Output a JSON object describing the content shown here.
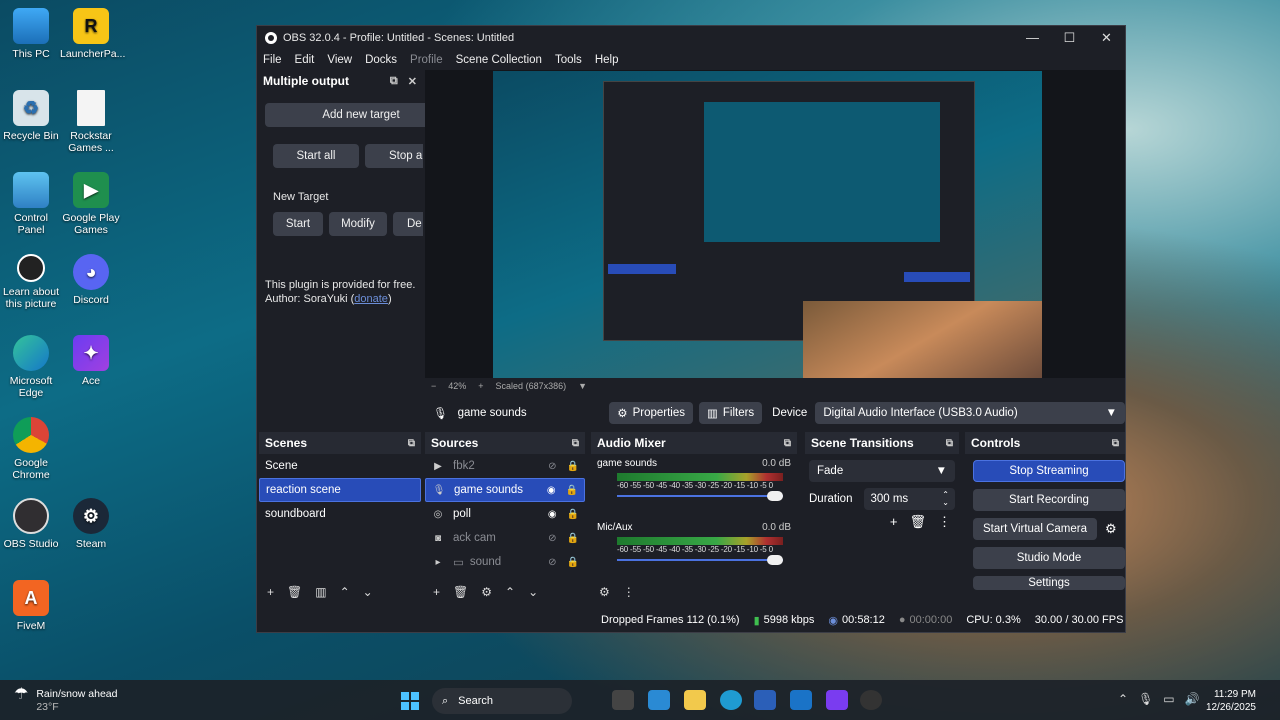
{
  "desktop": {
    "icons": [
      {
        "label": "This PC"
      },
      {
        "label": "LauncherPa..."
      },
      {
        "label": "Recycle Bin"
      },
      {
        "label": "Rockstar Games ..."
      },
      {
        "label": "Control Panel"
      },
      {
        "label": "Google Play Games"
      },
      {
        "label": "Learn about this picture"
      },
      {
        "label": "Discord"
      },
      {
        "label": "Microsoft Edge"
      },
      {
        "label": "Ace"
      },
      {
        "label": "Google Chrome"
      },
      {
        "label": "OBS Studio"
      },
      {
        "label": "Steam"
      },
      {
        "label": "FiveM"
      }
    ]
  },
  "window": {
    "title": "OBS 32.0.4 - Profile: Untitled - Scenes: Untitled",
    "controls": {
      "minimize": "—",
      "maximize": "☐",
      "close": "✕"
    }
  },
  "menu": [
    "File",
    "Edit",
    "View",
    "Docks",
    "Profile",
    "Scene Collection",
    "Tools",
    "Help"
  ],
  "multiple_output": {
    "title": "Multiple output",
    "add_target": "Add new target",
    "start_all": "Start all",
    "stop_all": "Stop a",
    "new_target": "New Target",
    "start": "Start",
    "modify": "Modify",
    "delete": "De",
    "plugin_note": "This plugin is provided for free.",
    "author_prefix": "Author: SoraYuki (",
    "donate": "donate",
    "author_suffix": ")"
  },
  "preview": {
    "zoom": "42%",
    "scaled": "Scaled (687x386)"
  },
  "source_toolbar": {
    "source": "game sounds",
    "properties": "Properties",
    "filters": "Filters",
    "device_label": "Device",
    "device_value": "Digital Audio Interface (USB3.0 Audio)"
  },
  "scenes": {
    "title": "Scenes",
    "items": [
      "Scene",
      "reaction scene",
      "soundboard"
    ]
  },
  "sources": {
    "title": "Sources",
    "items": [
      {
        "name": "fbk2"
      },
      {
        "name": "game sounds"
      },
      {
        "name": "poll"
      },
      {
        "name": "ack cam"
      },
      {
        "name": "sound"
      }
    ]
  },
  "mixer": {
    "title": "Audio Mixer",
    "channels": [
      {
        "name": "game sounds",
        "level": "0.0 dB"
      },
      {
        "name": "Mic/Aux",
        "level": "0.0 dB"
      }
    ],
    "ticks": "-60 -55 -50 -45 -40 -35 -30 -25 -20 -15 -10 -5 0"
  },
  "transitions": {
    "title": "Scene Transitions",
    "type": "Fade",
    "duration_label": "Duration",
    "duration_value": "300 ms"
  },
  "controls": {
    "title": "Controls",
    "stop_streaming": "Stop Streaming",
    "start_recording": "Start Recording",
    "start_virtual_camera": "Start Virtual Camera",
    "studio_mode": "Studio Mode",
    "settings": "Settings"
  },
  "status": {
    "dropped": "Dropped Frames 112 (0.1%)",
    "bitrate": "5998 kbps",
    "stream_time": "00:58:12",
    "rec_time": "00:00:00",
    "cpu": "CPU: 0.3%",
    "fps": "30.00 / 30.00 FPS"
  },
  "taskbar": {
    "weather_line1": "Rain/snow ahead",
    "weather_line2": "23°F",
    "search": "Search",
    "time": "11:29 PM",
    "date": "12/26/2025"
  }
}
